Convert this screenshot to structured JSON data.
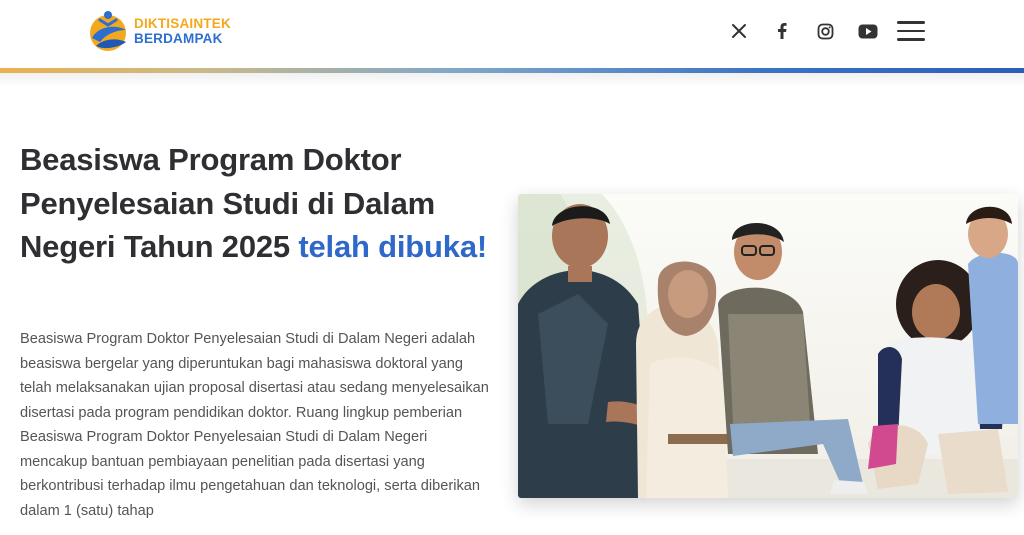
{
  "header": {
    "logo": {
      "line1": "DIKTISAINTEK",
      "line2": "BERDAMPAK"
    },
    "social": [
      {
        "icon": "x-icon"
      },
      {
        "icon": "facebook-icon"
      },
      {
        "icon": "instagram-icon"
      },
      {
        "icon": "youtube-icon"
      }
    ],
    "menu_icon": "hamburger-menu-icon"
  },
  "hero": {
    "headline_main": "Beasiswa Program Doktor Penyelesaian Studi di Dalam Negeri Tahun 2025",
    "headline_highlight": "telah dibuka!",
    "body": "Beasiswa Program Doktor Penyelesaian Studi di Dalam Negeri adalah beasiswa bergelar yang diperuntukan bagi mahasiswa doktoral yang telah melaksanakan ujian proposal disertasi atau sedang menyelesaikan disertasi pada program pendidikan doktor. Ruang lingkup pemberian Beasiswa Program Doktor Penyelesaian Studi di Dalam Negeri mencakup bantuan pembiayaan penelitian pada disertasi yang berkontribusi terhadap ilmu pengetahuan dan teknologi, serta diberikan dalam 1 (satu) tahap"
  },
  "colors": {
    "accent_blue": "#2f68c9",
    "accent_orange": "#f4a81d",
    "text_dark": "#2f2f33",
    "text_body": "#555555"
  }
}
